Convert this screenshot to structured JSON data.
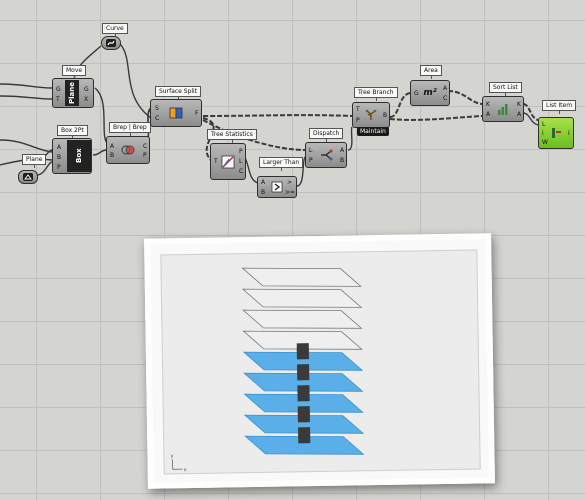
{
  "components": {
    "curve": {
      "title": "Curve"
    },
    "move": {
      "title": "Move",
      "inputs": [
        "G",
        "T"
      ],
      "outputs": [
        "G",
        "X"
      ],
      "tab": "Plane"
    },
    "box_2pt": {
      "title": "Box 2Pt",
      "inputs": [
        "A",
        "B",
        "P"
      ],
      "tab": "Box"
    },
    "plane": {
      "title": "Plane"
    },
    "brep_brep": {
      "title": "Brep | Brep",
      "inputs": [
        "A",
        "B"
      ],
      "outputs": [
        "C",
        "P"
      ]
    },
    "surface_split": {
      "title": "Surface Split",
      "inputs": [
        "S",
        "C"
      ],
      "outputs": [
        "F"
      ]
    },
    "tree_statistics": {
      "title": "Tree Statistics",
      "inputs": [
        "T"
      ],
      "outputs": [
        "P",
        "L",
        "C"
      ]
    },
    "larger_than": {
      "title": "Larger Than",
      "inputs": [
        "A",
        "B"
      ],
      "outputs": [
        ">",
        ">="
      ]
    },
    "dispatch": {
      "title": "Dispatch",
      "inputs": [
        "L",
        "P"
      ],
      "outputs": [
        "A",
        "B"
      ]
    },
    "tree_branch": {
      "title": "Tree Branch",
      "inputs": [
        "T",
        "P"
      ],
      "outputs": [
        "B"
      ],
      "tag": "Maintain"
    },
    "area": {
      "title": "Area",
      "inputs": [
        "G"
      ],
      "outputs": [
        "A",
        "C"
      ],
      "symbol": "m²"
    },
    "sort_list": {
      "title": "Sort List",
      "inputs": [
        "K",
        "A"
      ],
      "outputs": [
        "K",
        "A"
      ]
    },
    "list_item": {
      "title": "List Item",
      "inputs": [
        "L",
        "i",
        "W"
      ],
      "outputs": [
        "i"
      ]
    }
  },
  "viewport": {
    "plane_color": "#4aa8e8",
    "outline_color": "#777777",
    "box_color": "#3a3a3a",
    "axis_labels": [
      "y",
      "x"
    ],
    "outline_planes": 4,
    "filled_planes": 5
  },
  "colors": {
    "canvas": "#d4d4d0",
    "component": "#a0a0a0",
    "selected": "#8fd13a"
  }
}
